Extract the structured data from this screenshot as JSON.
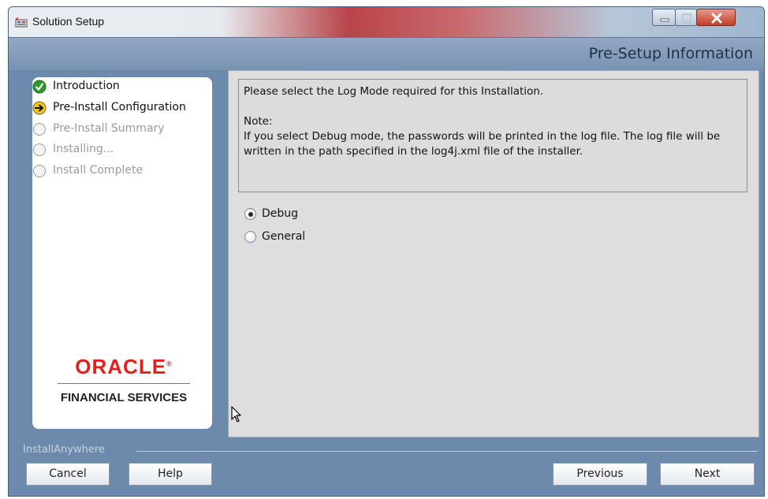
{
  "window": {
    "title": "Solution Setup",
    "icon": "installer-app-icon",
    "controls": [
      "minimize-icon",
      "maximize-icon",
      "close-icon"
    ]
  },
  "header": {
    "title": "Pre-Setup Information"
  },
  "steps": [
    {
      "label": "Introduction",
      "state": "done",
      "icon": "checkmark-icon"
    },
    {
      "label": "Pre-Install Configuration",
      "state": "current",
      "icon": "arrow-right-icon"
    },
    {
      "label": "Pre-Install Summary",
      "state": "pending",
      "icon": "empty-circle-icon"
    },
    {
      "label": "Installing...",
      "state": "pending",
      "icon": "empty-circle-icon"
    },
    {
      "label": "Install Complete",
      "state": "pending",
      "icon": "empty-circle-icon"
    }
  ],
  "logo": {
    "brand": "ORACLE",
    "registered": "®",
    "subtitle": "FINANCIAL SERVICES"
  },
  "content": {
    "question": "Please select the Log Mode required for this Installation.",
    "note_label": "Note:",
    "note_text": "If you select Debug mode, the passwords will be printed in the log file. The log file will be written in the path specified in the log4j.xml file of the installer.",
    "options": [
      {
        "label": "Debug",
        "selected": true
      },
      {
        "label": "General",
        "selected": false
      }
    ]
  },
  "footer": {
    "brand": "InstallAnywhere",
    "cancel": "Cancel",
    "help": "Help",
    "previous": "Previous",
    "next": "Next"
  },
  "colors": {
    "window_bg": "#6d89ab",
    "oracle_red": "#e2211c",
    "done_green": "#2e9a2e",
    "current_yellow": "#f2c318"
  }
}
